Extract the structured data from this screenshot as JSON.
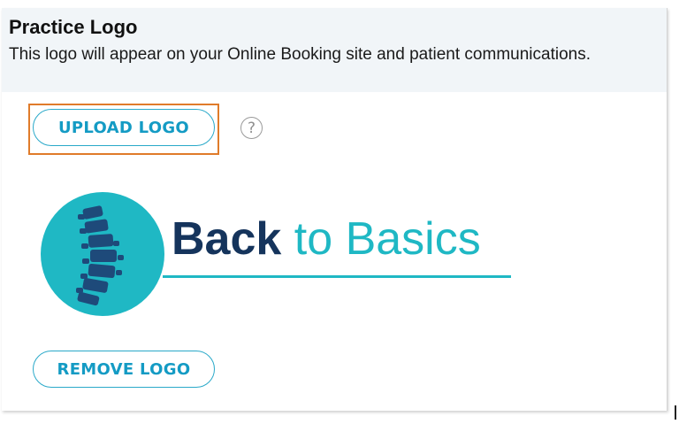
{
  "section": {
    "title": "Practice Logo",
    "description": "This logo will appear on your Online Booking site and patient communications."
  },
  "actions": {
    "upload_label": "UPLOAD LOGO",
    "remove_label": "REMOVE LOGO",
    "help_glyph": "?"
  },
  "logo": {
    "word_primary": "Back",
    "word_secondary": "to Basics",
    "colors": {
      "circle": "#1fb8c4",
      "spine": "#1e4a7a",
      "primary_text": "#15345c",
      "secondary_text": "#1fb8c4"
    }
  },
  "colors": {
    "accent": "#149bc4",
    "highlight_outline": "#e07b2a",
    "header_background": "#f1f5f8"
  }
}
